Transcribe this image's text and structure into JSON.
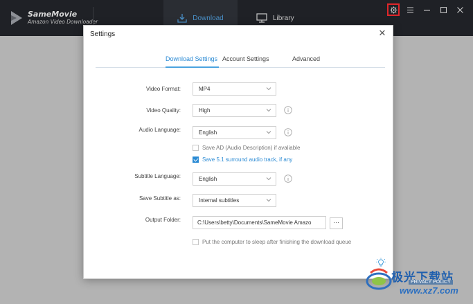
{
  "app": {
    "name": "SameMovie",
    "subtitle": "Amazon Video Downloader",
    "tabs": [
      {
        "label": "Download",
        "icon": "download-icon",
        "active": true
      },
      {
        "label": "Library",
        "icon": "monitor-icon",
        "active": false
      }
    ],
    "window_controls": [
      "gear-icon",
      "menu-icon",
      "minimize-icon",
      "maximize-icon",
      "close-icon"
    ],
    "accent": "#2a8ad4",
    "highlight": "#e0262a"
  },
  "settings": {
    "title": "Settings",
    "close_glyph": "✕",
    "tabs": [
      {
        "label": "Download Settings",
        "active": true
      },
      {
        "label": "Account Settings",
        "active": false
      },
      {
        "label": "Advanced",
        "active": false
      }
    ],
    "video_format": {
      "label": "Video Format:",
      "value": "MP4"
    },
    "video_quality": {
      "label": "Video Quality:",
      "value": "High"
    },
    "audio_language": {
      "label": "Audio Language:",
      "value": "English"
    },
    "save_ad": {
      "label": "Save AD (Audio Description) if avaliable",
      "checked": false
    },
    "save_51": {
      "label": "Save 5.1 surround audio track, if any",
      "checked": true
    },
    "subtitle_language": {
      "label": "Subtitle Language:",
      "value": "English"
    },
    "save_subtitle_as": {
      "label": "Save Subtitle as:",
      "value": "Internal subtitles"
    },
    "output_folder": {
      "label": "Output Folder:",
      "value": "C:\\Users\\betty\\Documents\\SameMovie Amazo",
      "browse": "···"
    },
    "sleep": {
      "label": "Put the computer to sleep after finishing the download queue",
      "checked": false
    }
  },
  "watermark": {
    "text": "极光下载站",
    "url": "www.xz7.com",
    "privacy": "PRIVACY POLICY"
  }
}
